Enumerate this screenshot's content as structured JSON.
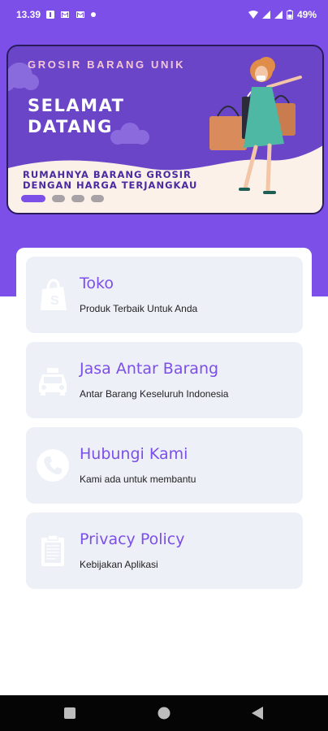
{
  "status_bar": {
    "time": "13.39",
    "battery": "49%",
    "icons": [
      "notification-icon",
      "gmail-icon",
      "gmail-icon",
      "dot-icon",
      "wifi-icon",
      "signal-icon",
      "signal-icon",
      "battery-icon"
    ]
  },
  "banner": {
    "subtitle": "GROSIR BARANG UNIK",
    "title": "SELAMAT DATANG",
    "tagline": "RUMAHNYA BARANG GROSIR DENGAN HARGA TERJANGKAU",
    "slide_count": 4,
    "active_slide": 1
  },
  "menu": {
    "items": [
      {
        "title": "Toko",
        "description": "Produk Terbaik Untuk Anda",
        "icon": "shopify-bag-icon"
      },
      {
        "title": "Jasa Antar Barang",
        "description": "Antar Barang Keseluruh Indonesia",
        "icon": "car-icon"
      },
      {
        "title": "Hubungi Kami",
        "description": "Kami ada untuk membantu",
        "icon": "phone-icon"
      },
      {
        "title": "Privacy Policy",
        "description": "Kebijakan Aplikasi",
        "icon": "clipboard-icon"
      }
    ]
  },
  "nav_bar": {
    "buttons": [
      "recents-button",
      "home-button",
      "back-button"
    ]
  },
  "colors": {
    "accent": "#7b4fe8",
    "card": "#eef0f8",
    "banner_cream": "#fbf1e8"
  }
}
